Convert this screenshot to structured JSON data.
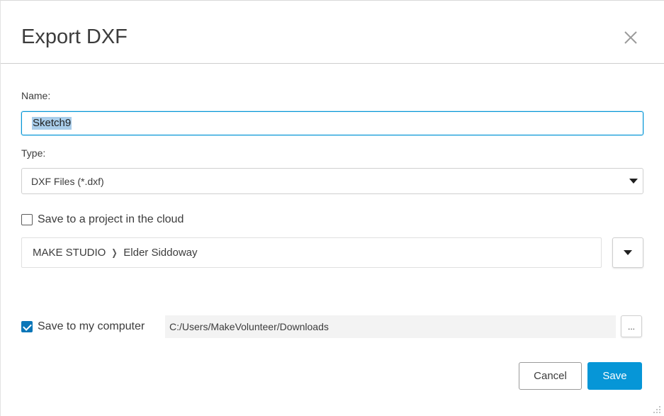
{
  "dialog": {
    "title": "Export DXF"
  },
  "name": {
    "label": "Name:",
    "value": "Sketch9"
  },
  "type": {
    "label": "Type:",
    "selected": "DXF Files (*.dxf)"
  },
  "cloud": {
    "label": "Save to a project in the cloud",
    "checked": false,
    "project_team": "MAKE STUDIO",
    "project_name": "Elder Siddoway"
  },
  "computer": {
    "label": "Save to my computer",
    "checked": true,
    "path": "C:/Users/MakeVolunteer/Downloads",
    "browse_label": "..."
  },
  "footer": {
    "cancel_label": "Cancel",
    "save_label": "Save"
  },
  "colors": {
    "accent": "#0696d7",
    "checkbox": "#0a76b8",
    "selection": "#a9cdea"
  },
  "icons": {
    "close": "close-icon",
    "dropdown": "caret-down-icon",
    "breadcrumb": "chevron-right-icon",
    "resize": "resize-grip-icon"
  }
}
